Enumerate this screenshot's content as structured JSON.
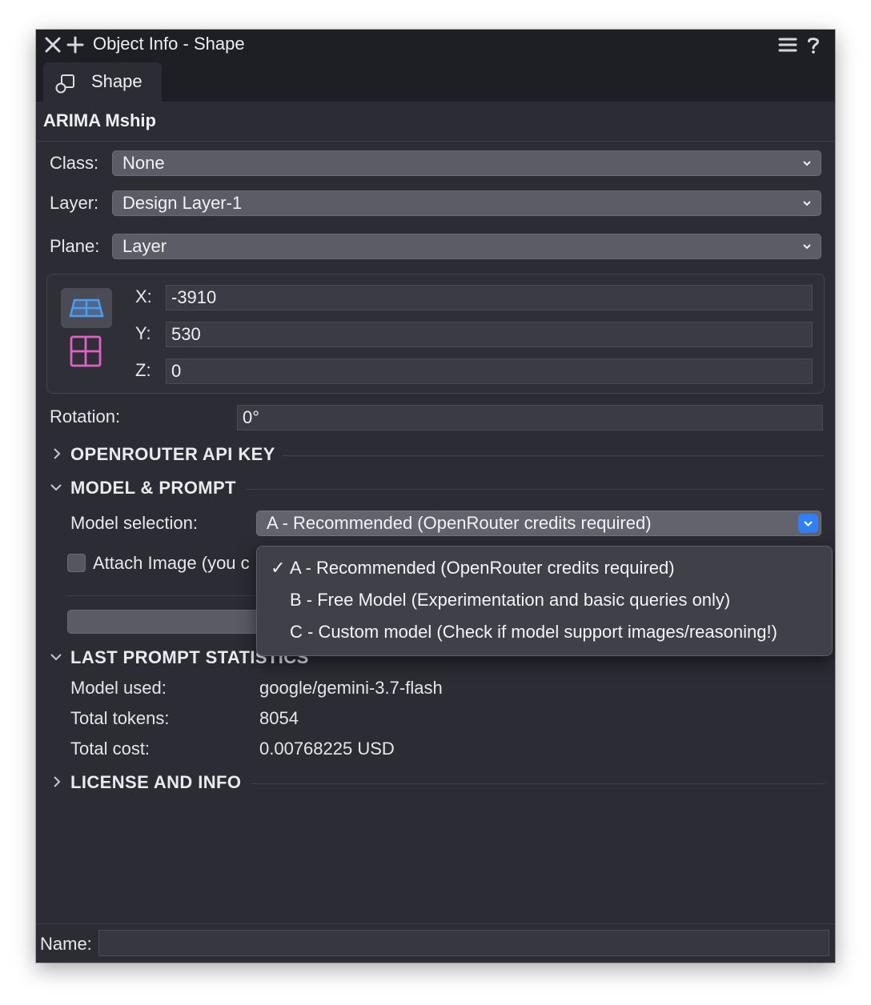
{
  "window": {
    "title": "Object Info - Shape",
    "tabs": [
      {
        "label": "Shape",
        "icon": "shape-icon"
      }
    ]
  },
  "object_type": "ARIMA Mship",
  "properties": {
    "class": {
      "label": "Class:",
      "value": "None"
    },
    "layer": {
      "label": "Layer:",
      "value": "Design Layer-1"
    },
    "plane": {
      "label": "Plane:",
      "value": "Layer"
    }
  },
  "coordinates": {
    "x": {
      "label": "X:",
      "value": "-3910"
    },
    "y": {
      "label": "Y:",
      "value": "530"
    },
    "z": {
      "label": "Z:",
      "value": "0"
    }
  },
  "rotation": {
    "label": "Rotation:",
    "value": "0°"
  },
  "sections": {
    "api_key": {
      "title": "OPENROUTER API KEY",
      "expanded": false
    },
    "model_prompt": {
      "title": "MODEL & PROMPT",
      "expanded": true,
      "model_selection_label": "Model selection:",
      "model_selection_value": "A - Recommended (OpenRouter credits required)",
      "attach_image_label": "Attach Image (you c",
      "attach_image_checked": false,
      "options": [
        {
          "label": "A - Recommended (OpenRouter credits required)",
          "selected": true
        },
        {
          "label": "B - Free Model (Experimentation and basic queries only)",
          "selected": false
        },
        {
          "label": "C - Custom model (Check if model support images/reasoning!)",
          "selected": false
        }
      ],
      "check_mark": "✓"
    },
    "last_prompt": {
      "title": "LAST PROMPT STATISTICS",
      "expanded": true,
      "rows": [
        {
          "key": "Model used:",
          "value": "google/gemini-3.7-flash"
        },
        {
          "key": "Total tokens:",
          "value": "8054"
        },
        {
          "key": "Total cost:",
          "value": "0.00768225 USD"
        }
      ]
    },
    "license": {
      "title": "LICENSE AND INFO",
      "expanded": false
    }
  },
  "name_field": {
    "label": "Name:",
    "value": ""
  },
  "colors": {
    "panel_bg": "#2b2c34",
    "titlebar_bg": "#1e1f24",
    "accent": "#2f7ff5",
    "plane_icon_blue": "#4a9ef0",
    "plane_icon_pink": "#e060c8"
  }
}
